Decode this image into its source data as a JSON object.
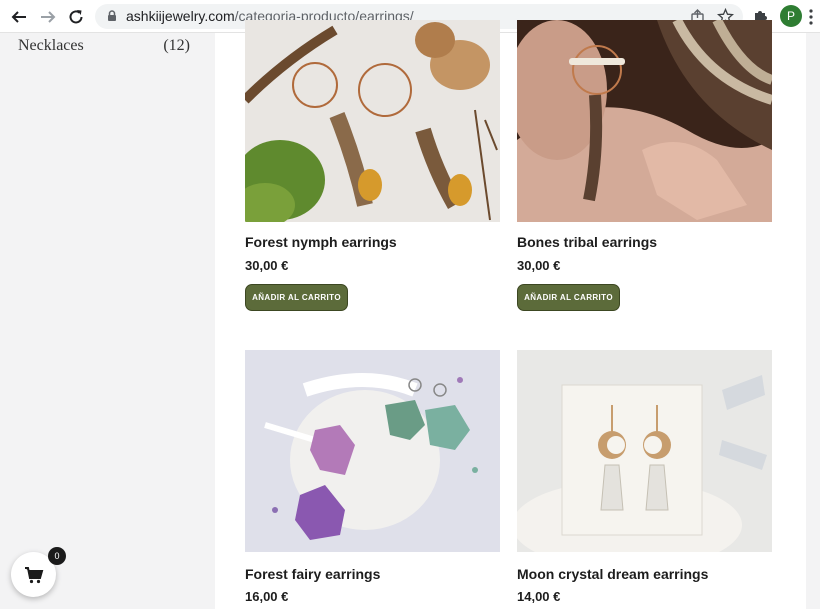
{
  "browser": {
    "url_host": "ashkiijewelry.com",
    "url_path": "/categoria-producto/earrings/",
    "profile_initial": "P",
    "icons": [
      "back-arrow-icon",
      "forward-arrow-icon",
      "reload-icon",
      "lock-icon",
      "share-icon",
      "star-icon",
      "puzzle-icon",
      "kebab-menu-icon"
    ]
  },
  "sidebar": {
    "category": {
      "label": "Necklaces",
      "count": "(12)"
    }
  },
  "products": [
    {
      "name": "Forest nymph earrings",
      "price": "30,00 €",
      "button": "AÑADIR AL CARRITO"
    },
    {
      "name": "Bones tribal earrings",
      "price": "30,00 €",
      "button": "AÑADIR AL CARRITO"
    },
    {
      "name": "Forest fairy earrings",
      "price": "16,00 €"
    },
    {
      "name": "Moon crystal dream earrings",
      "price": "14,00 €"
    }
  ],
  "cart": {
    "count": "0"
  },
  "colors": {
    "button_bg": "#5c6b3a",
    "sidebar_bg": "#f3f3f4",
    "profile_bg": "#2e7d32"
  }
}
